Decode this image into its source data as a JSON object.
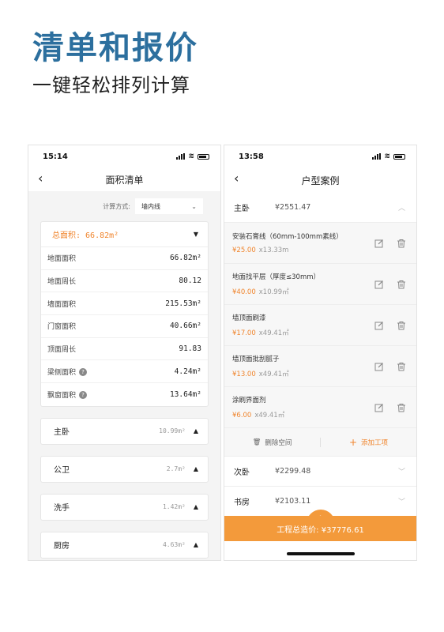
{
  "headline": "清单和报价",
  "subline": "一键轻松排列计算",
  "left_phone": {
    "time": "15:14",
    "title": "面积清单",
    "calc_label": "计算方式:",
    "calc_value": "墙内线",
    "total": "总面积: 66.82m²",
    "rows": [
      {
        "label": "地面面积",
        "value": "66.82m²",
        "help": false
      },
      {
        "label": "地面周长",
        "value": "80.12",
        "help": false
      },
      {
        "label": "墙面面积",
        "value": "215.53m²",
        "help": false
      },
      {
        "label": "门窗面积",
        "value": "40.66m²",
        "help": false
      },
      {
        "label": "顶面周长",
        "value": "91.83",
        "help": false
      },
      {
        "label": "梁侧面积",
        "value": "4.24m²",
        "help": true
      },
      {
        "label": "飘窗面积",
        "value": "13.64m²",
        "help": true
      }
    ],
    "rooms": [
      {
        "name": "主卧",
        "area": "10.99m²"
      },
      {
        "name": "公卫",
        "area": "2.7m²"
      },
      {
        "name": "洗手",
        "area": "1.42m²"
      },
      {
        "name": "厨房",
        "area": "4.63m²"
      }
    ]
  },
  "right_phone": {
    "time": "13:58",
    "title": "户型案例",
    "main_section": {
      "name": "主卧",
      "price": "¥2551.47"
    },
    "items": [
      {
        "name": "安装石膏线（60mm-100mm素线）",
        "price": "¥25.00",
        "qty": "x13.33m"
      },
      {
        "name": "地面找平层（厚度≤30mm）",
        "price": "¥40.00",
        "qty": "x10.99㎡"
      },
      {
        "name": "墙顶面刷漆",
        "price": "¥17.00",
        "qty": "x49.41㎡"
      },
      {
        "name": "墙顶面批刮腻子",
        "price": "¥13.00",
        "qty": "x49.41㎡"
      },
      {
        "name": "涂刷界面剂",
        "price": "¥6.00",
        "qty": "x49.41㎡"
      }
    ],
    "delete_label": "删除空间",
    "add_label": "添加工项",
    "sections": [
      {
        "name": "次卧",
        "price": "¥2299.48"
      },
      {
        "name": "书房",
        "price": "¥2103.11"
      }
    ],
    "total": "工程总造价: ¥37776.61"
  },
  "colors": {
    "accent": "#f39a3b",
    "orange_text": "#f0852d",
    "headline": "#2c6f9e"
  }
}
